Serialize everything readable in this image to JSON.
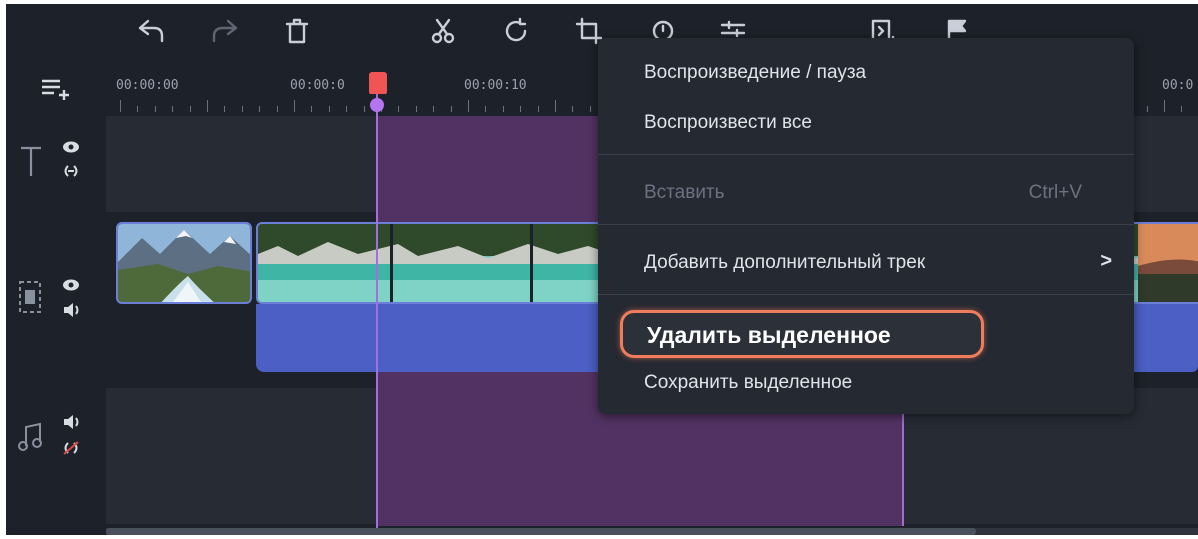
{
  "toolbar": {
    "icons": [
      "undo-icon",
      "redo-icon",
      "delete-icon",
      "cut-icon",
      "rotate-icon",
      "crop-icon",
      "clip-properties-icon",
      "adjust-icon",
      "export-icon",
      "marker-icon"
    ]
  },
  "ruler": {
    "labels": [
      "00:00:00",
      "00:00:0",
      "00:00:10",
      "00:0"
    ]
  },
  "tracks": {
    "titles": {
      "icon": "title-track-icon"
    },
    "video": {
      "icon": "video-track-icon"
    },
    "audio": {
      "icon": "music-track-icon"
    }
  },
  "context_menu": {
    "play_pause": "Воспроизведение / пауза",
    "play_all": "Воспроизвести все",
    "paste": "Вставить",
    "paste_shortcut": "Ctrl+V",
    "add_track": "Добавить дополнительный трек",
    "add_track_arrow": ">",
    "delete_selected": "Удалить выделенное",
    "save_selected": "Сохранить выделенное"
  },
  "colors": {
    "background": "#1d2129",
    "selection": "#523262",
    "audio_lane": "#4b5fc4",
    "playhead_head": "#f05454",
    "highlight_border": "#ef7c5a"
  }
}
